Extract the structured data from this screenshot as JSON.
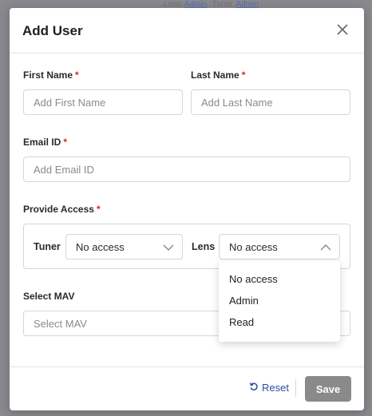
{
  "backdrop": {
    "text_1": "Lens",
    "link_1": "Admin",
    "text_2": "Tuner",
    "link_2": "Admin"
  },
  "modal": {
    "title": "Add User"
  },
  "form": {
    "first_name": {
      "label": "First Name",
      "required": "*",
      "placeholder": "Add First Name",
      "value": ""
    },
    "last_name": {
      "label": "Last Name",
      "required": "*",
      "placeholder": "Add Last Name",
      "value": ""
    },
    "email": {
      "label": "Email ID",
      "required": "*",
      "placeholder": "Add Email ID",
      "value": ""
    },
    "access": {
      "label": "Provide Access",
      "required": "*",
      "tuner": {
        "label": "Tuner",
        "selected": "No access"
      },
      "lens": {
        "label": "Lens",
        "selected": "No access",
        "open": true
      }
    },
    "mav": {
      "label": "Select MAV",
      "placeholder": "Select MAV"
    }
  },
  "dropdown": {
    "options": [
      "No access",
      "Admin",
      "Read"
    ]
  },
  "footer": {
    "reset_label": "Reset",
    "save_label": "Save"
  },
  "colors": {
    "link": "#2f4d9f",
    "required": "#e02020",
    "save_disabled": "#8a8a8a"
  }
}
